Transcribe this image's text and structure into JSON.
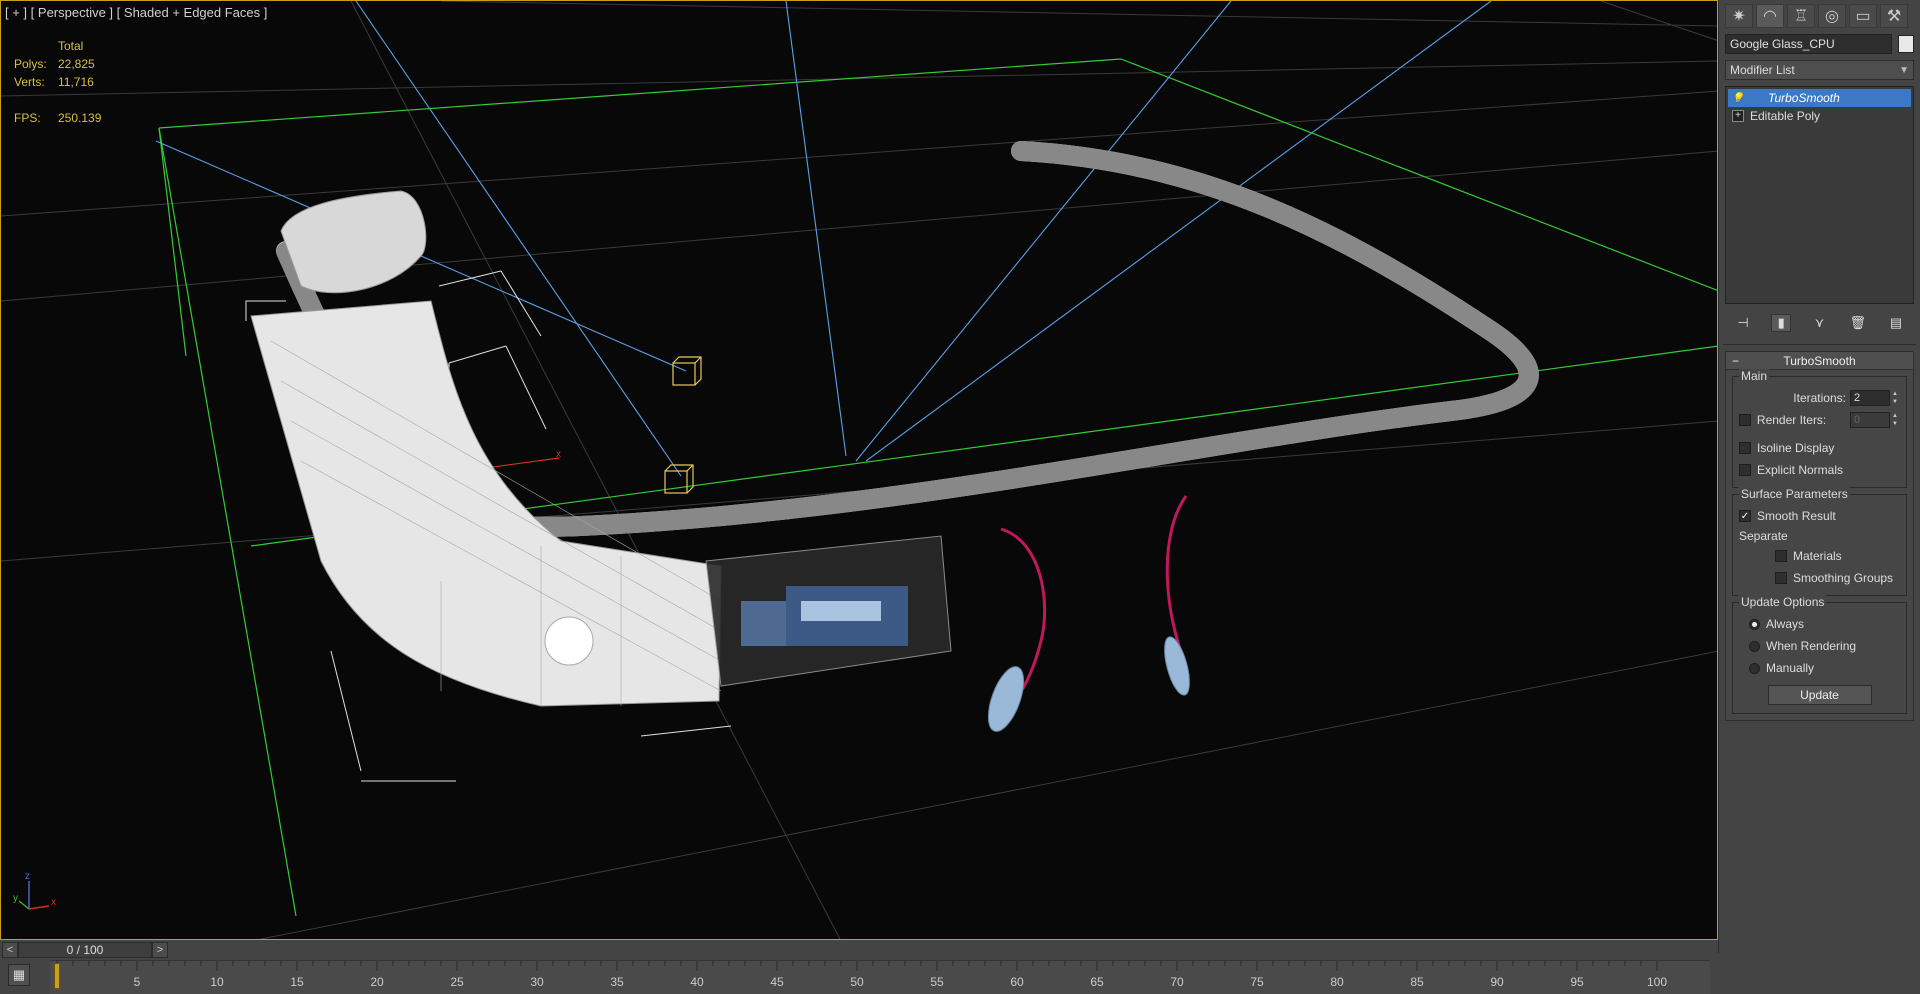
{
  "viewport": {
    "label_parts": [
      "[ + ]",
      "[ Perspective ]",
      "[ Shaded + Edged Faces ]"
    ],
    "stats": {
      "header": "Total",
      "polys_label": "Polys:",
      "polys_value": "22,825",
      "verts_label": "Verts:",
      "verts_value": "11,716",
      "fps_label": "FPS:",
      "fps_value": "250.139"
    },
    "axis_labels": {
      "x": "x",
      "y": "y",
      "z": "z"
    },
    "colors": {
      "border_active": "#c8a018",
      "grid_green": "#33cc33",
      "camera_blue": "#5aa0e8",
      "cable": "#c0185a"
    }
  },
  "command_panel": {
    "tabs": [
      {
        "icon": "create-icon"
      },
      {
        "icon": "modify-icon"
      },
      {
        "icon": "hierarchy-icon"
      },
      {
        "icon": "motion-icon"
      },
      {
        "icon": "display-icon"
      },
      {
        "icon": "utilities-icon"
      }
    ],
    "object_name": "Google Glass_CPU",
    "modifier_list_label": "Modifier List",
    "stack": [
      {
        "label": "TurboSmooth",
        "selected": true,
        "icon": "lightbulb-icon"
      },
      {
        "label": "Editable Poly",
        "selected": false,
        "icon": "expand-plus-icon"
      }
    ],
    "stack_tools": [
      "pin-stack-icon",
      "show-end-result-icon",
      "make-unique-icon",
      "remove-modifier-icon",
      "configure-sets-icon"
    ]
  },
  "turbosmooth": {
    "rollout_title": "TurboSmooth",
    "main_group": "Main",
    "iterations_label": "Iterations:",
    "iterations_value": "2",
    "render_iters_label": "Render Iters:",
    "render_iters_value": "0",
    "isoline_label": "Isoline Display",
    "explicit_normals_label": "Explicit Normals",
    "surface_group": "Surface Parameters",
    "smooth_result_label": "Smooth Result",
    "separate_label": "Separate",
    "materials_label": "Materials",
    "smoothing_groups_label": "Smoothing Groups",
    "update_group": "Update Options",
    "always_label": "Always",
    "when_rendering_label": "When Rendering",
    "manually_label": "Manually",
    "update_button": "Update"
  },
  "timeline": {
    "slider_text": "0 / 100",
    "prev_label": "<",
    "next_label": ">",
    "tick_labels": [
      "5",
      "10",
      "15",
      "20",
      "25",
      "30",
      "35",
      "40",
      "45",
      "50",
      "55",
      "60",
      "65",
      "70",
      "75",
      "80",
      "85",
      "90",
      "95",
      "100"
    ]
  }
}
